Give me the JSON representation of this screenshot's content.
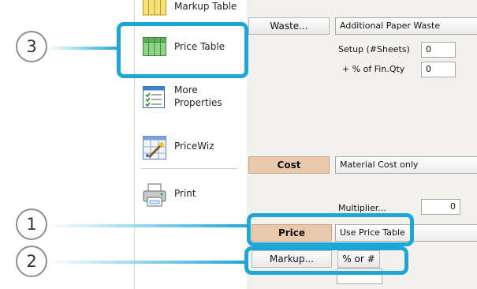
{
  "sidebar": {
    "items": [
      {
        "label": "Markup Table",
        "icon": "markup-table-icon"
      },
      {
        "label": "Price Table",
        "icon": "price-table-icon"
      },
      {
        "label_line1": "More",
        "label_line2": "Properties",
        "icon": "more-properties-icon"
      },
      {
        "label": "PriceWiz",
        "icon": "pricewiz-icon"
      },
      {
        "label": "Print",
        "icon": "printer-icon"
      }
    ]
  },
  "main": {
    "waste_button": "Waste...",
    "waste_select": "Additional Paper Waste",
    "setup_label": "Setup (#Sheets)",
    "setup_value": "0",
    "fin_label": "+ % of Fin.Qty",
    "fin_value": "0",
    "cost_button": "Cost",
    "cost_select": "Material Cost only",
    "multiplier_label": "Multiplier...",
    "multiplier_value": "0",
    "price_button": "Price",
    "price_select": "Use Price Table",
    "markup_button": "Markup...",
    "markup_mode_button": "% or #"
  },
  "callouts": [
    {
      "number": "3"
    },
    {
      "number": "1"
    },
    {
      "number": "2"
    }
  ],
  "colors": {
    "callout": "#1da6d6",
    "tan_button": "#e8c9ad",
    "panel_bg": "#f2f1ee"
  }
}
